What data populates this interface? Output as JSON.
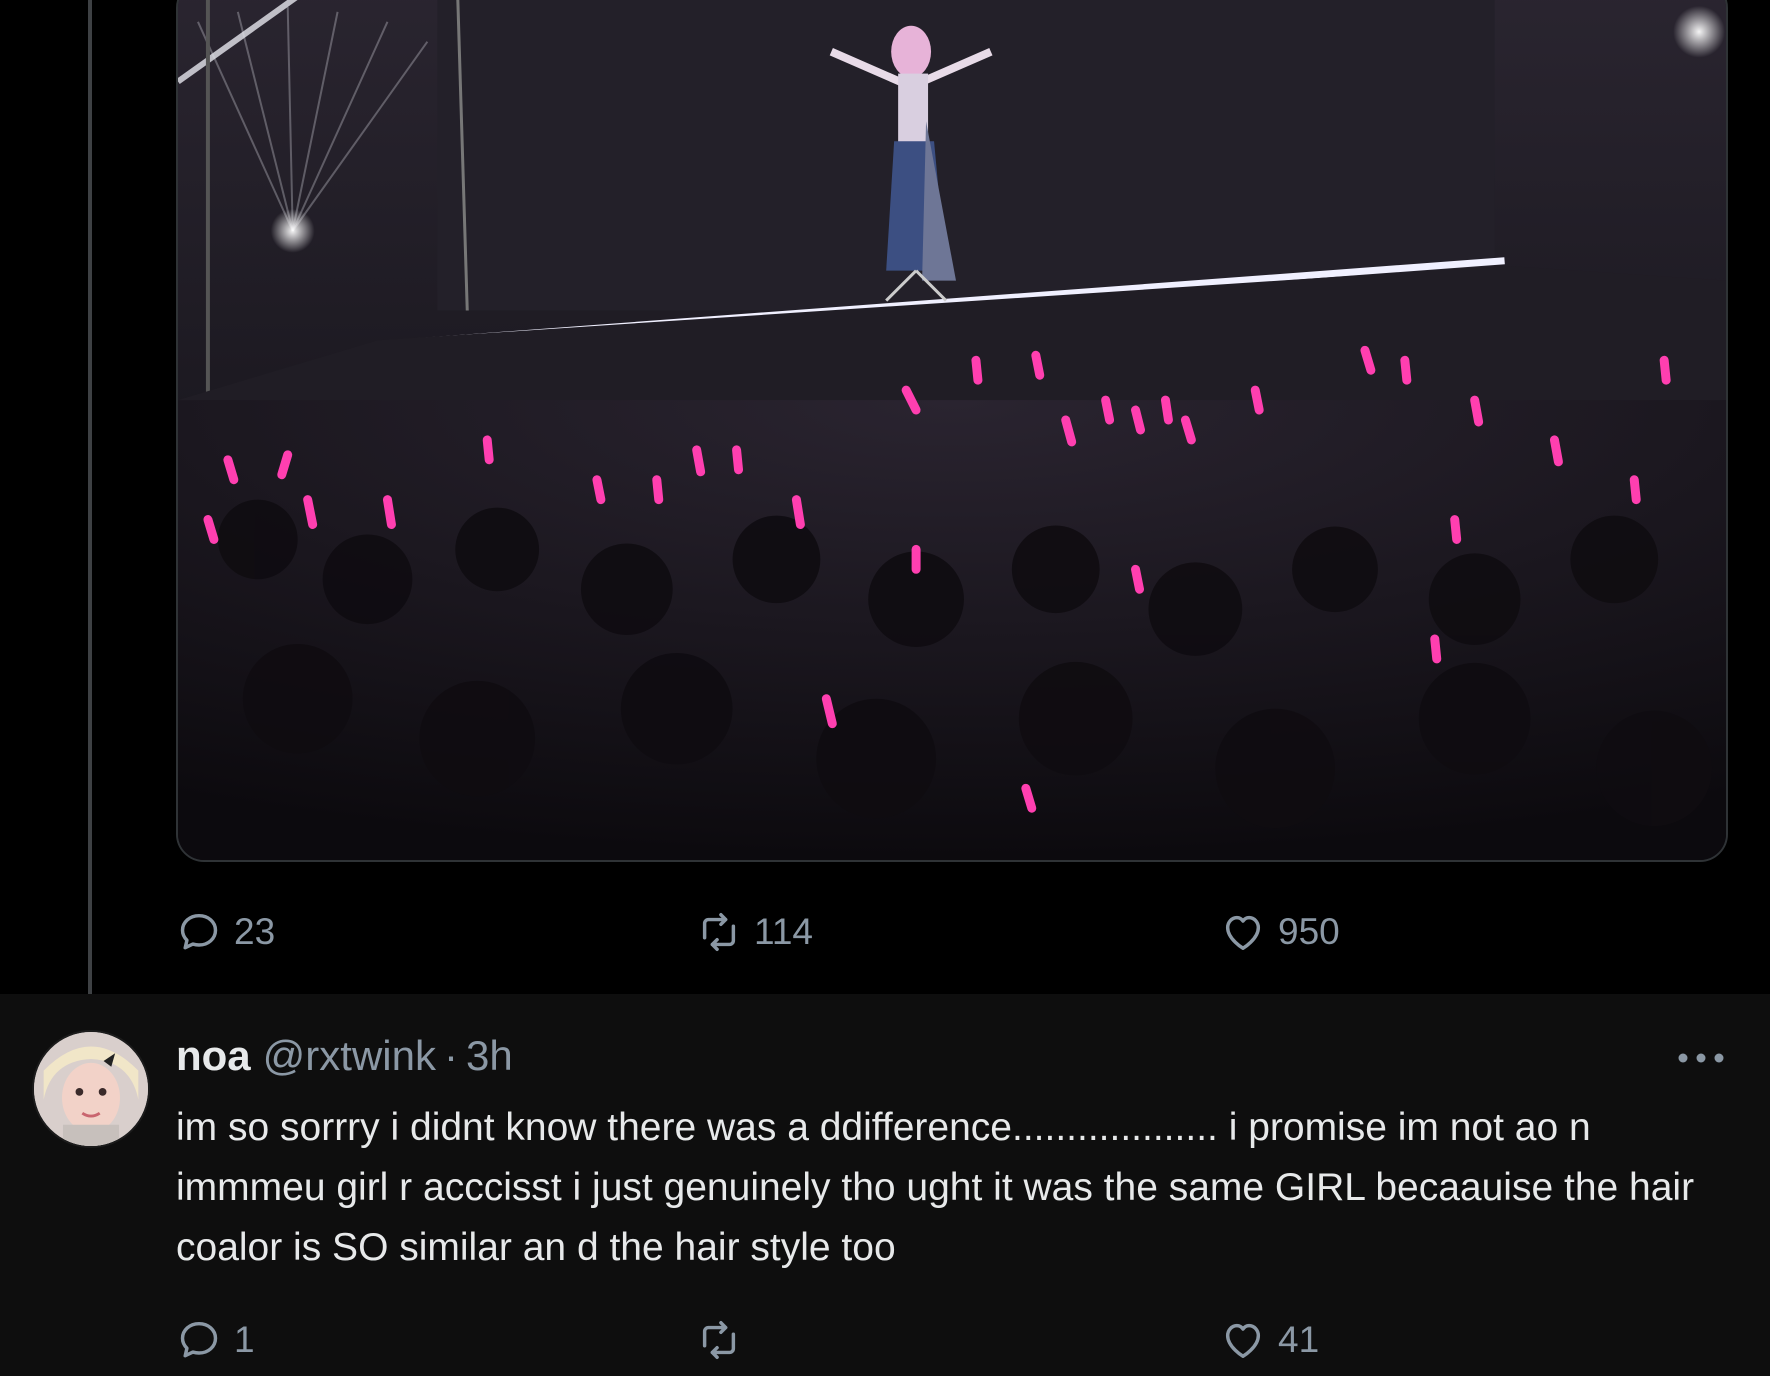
{
  "post": {
    "media": {
      "alt": "",
      "icon": "concert-photo"
    },
    "actions": {
      "reply_count": "23",
      "repost_count": "114",
      "like_count": "950"
    }
  },
  "reply": {
    "display_name": "noa",
    "handle": "@rxtwink",
    "separator": "·",
    "time": "3h",
    "text": "im so sorrry i didnt know there was a ddifference................... i promise im not ao n immmeu girl r acccisst i just genuinely tho ught it was the same GIRL becaauise the hair coalor is SO similar an d the hair style too",
    "actions": {
      "reply_count": "1",
      "repost_count": "",
      "like_count": "41"
    }
  },
  "colors": {
    "background": "#000000",
    "reply_background": "#0e0e0e",
    "muted_text": "#8b98a5",
    "glowstick": "#ff3fb0"
  },
  "icons": [
    "reply-icon",
    "repost-icon",
    "like-icon",
    "more-icon",
    "avatar"
  ]
}
